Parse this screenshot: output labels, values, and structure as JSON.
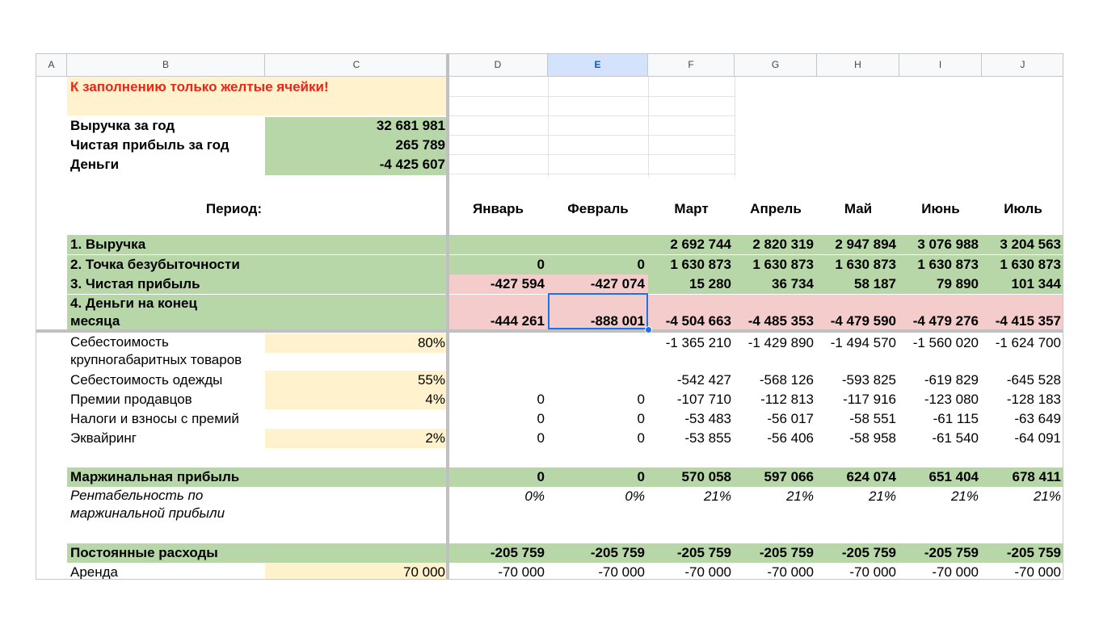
{
  "columns": [
    "A",
    "B",
    "C",
    "D",
    "E",
    "F",
    "G",
    "H",
    "I",
    "J"
  ],
  "selected_column": "E",
  "colors": {
    "green": "#b7d7a8",
    "yellow": "#fff2cc",
    "pink": "#f4cccc",
    "red_text": "#e8261b",
    "selection": "#1a73e8"
  },
  "notice": "К заполнению только желтые ячейки!",
  "summary": [
    {
      "label": "Выручка за год",
      "value": "32 681 981"
    },
    {
      "label": "Чистая прибыль за год",
      "value": "265 789"
    },
    {
      "label": "Деньги",
      "value": "-4 425 607"
    }
  ],
  "period_label": "Период:",
  "months": [
    "Январь",
    "Февраль",
    "Март",
    "Апрель",
    "Май",
    "Июнь",
    "Июль"
  ],
  "rows": [
    {
      "label": "1. Выручка",
      "param": "",
      "values": [
        "",
        "",
        "2 692 744",
        "2 820 319",
        "2 947 894",
        "3 076 988",
        "3 204 563"
      ]
    },
    {
      "label": "2. Точка безубыточности",
      "param": "",
      "values": [
        "0",
        "0",
        "1 630 873",
        "1 630 873",
        "1 630 873",
        "1 630 873",
        "1 630 873"
      ]
    },
    {
      "label": "3. Чистая прибыль",
      "param": "",
      "values": [
        "-427 594",
        "-427 074",
        "15 280",
        "36 734",
        "58 187",
        "79 890",
        "101 344"
      ]
    },
    {
      "label": "4. Деньги на конец месяца",
      "param": "",
      "values": [
        "-444 261",
        "-888 001",
        "-4 504 663",
        "-4 485 353",
        "-4 479 590",
        "-4 479 276",
        "-4 415 357"
      ]
    },
    {
      "label": "Себестоимость крупногабаритных товаров",
      "param": "80%",
      "values": [
        "",
        "",
        "-1 365 210",
        "-1 429 890",
        "-1 494 570",
        "-1 560 020",
        "-1 624 700"
      ]
    },
    {
      "label": "Себестоимость одежды",
      "param": "55%",
      "values": [
        "",
        "",
        "-542 427",
        "-568 126",
        "-593 825",
        "-619 829",
        "-645 528"
      ]
    },
    {
      "label": "Премии продавцов",
      "param": "4%",
      "values": [
        "0",
        "0",
        "-107 710",
        "-112 813",
        "-117 916",
        "-123 080",
        "-128 183"
      ]
    },
    {
      "label": "Налоги и взносы с премий",
      "param": "",
      "values": [
        "0",
        "0",
        "-53 483",
        "-56 017",
        "-58 551",
        "-61 115",
        "-63 649"
      ]
    },
    {
      "label": "Эквайринг",
      "param": "2%",
      "values": [
        "0",
        "0",
        "-53 855",
        "-56 406",
        "-58 958",
        "-61 540",
        "-64 091"
      ]
    },
    {
      "label": "Маржинальная прибыль",
      "param": "",
      "values": [
        "0",
        "0",
        "570 058",
        "597 066",
        "624 074",
        "651 404",
        "678 411"
      ]
    },
    {
      "label": "Рентабельность по маржинальной прибыли",
      "param": "",
      "values": [
        "0%",
        "0%",
        "21%",
        "21%",
        "21%",
        "21%",
        "21%"
      ]
    },
    {
      "label": "Постоянные расходы",
      "param": "",
      "values": [
        "-205 759",
        "-205 759",
        "-205 759",
        "-205 759",
        "-205 759",
        "-205 759",
        "-205 759"
      ]
    },
    {
      "label": "Аренда",
      "param": "70 000",
      "values": [
        "-70 000",
        "-70 000",
        "-70 000",
        "-70 000",
        "-70 000",
        "-70 000",
        "-70 000"
      ]
    }
  ]
}
